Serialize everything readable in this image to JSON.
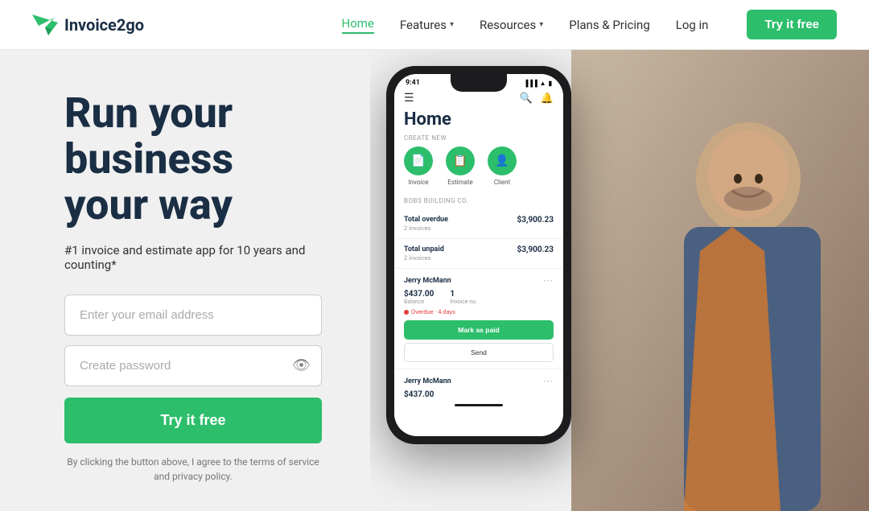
{
  "header": {
    "logo_text": "Invoice2go",
    "nav": {
      "home": "Home",
      "features": "Features",
      "resources": "Resources",
      "plans": "Plans & Pricing",
      "login": "Log in",
      "try_free": "Try it free"
    }
  },
  "hero": {
    "title_line1": "Run your",
    "title_line2": "business",
    "title_line3": "your way",
    "subtitle": "#1 invoice and estimate app for 10 years and counting*",
    "email_placeholder": "Enter your email address",
    "password_placeholder": "Create password",
    "cta_button": "Try it free",
    "disclaimer": "By clicking the button above, I agree to the terms of service and privacy policy."
  },
  "phone": {
    "status_time": "9:41",
    "app_title": "Home",
    "create_new_label": "CREATE NEW",
    "icons": [
      {
        "label": "Invoice",
        "symbol": "📄"
      },
      {
        "label": "Estimate",
        "symbol": "📋"
      },
      {
        "label": "Client",
        "symbol": "👤"
      }
    ],
    "business_name": "BOBS BUILDING CO.",
    "stats": [
      {
        "label": "Total overdue",
        "sub": "2 invoices",
        "value": "$3,900.23"
      },
      {
        "label": "Total unpaid",
        "sub": "2 invoices",
        "value": "$3,900.23"
      }
    ],
    "client": {
      "name": "Jerry McMann",
      "balance": "$437.00",
      "balance_label": "Balance",
      "invoices": "1",
      "invoice_label": "Invoice no.",
      "overdue_text": "Overdue · 4 days",
      "mark_paid": "Mark as paid",
      "send": "Send"
    },
    "client2": {
      "name": "Jerry McMann",
      "amount": "$437.00"
    }
  },
  "colors": {
    "green": "#2dbe6c",
    "dark": "#1a2e44",
    "light_bg": "#f0f0f0"
  }
}
